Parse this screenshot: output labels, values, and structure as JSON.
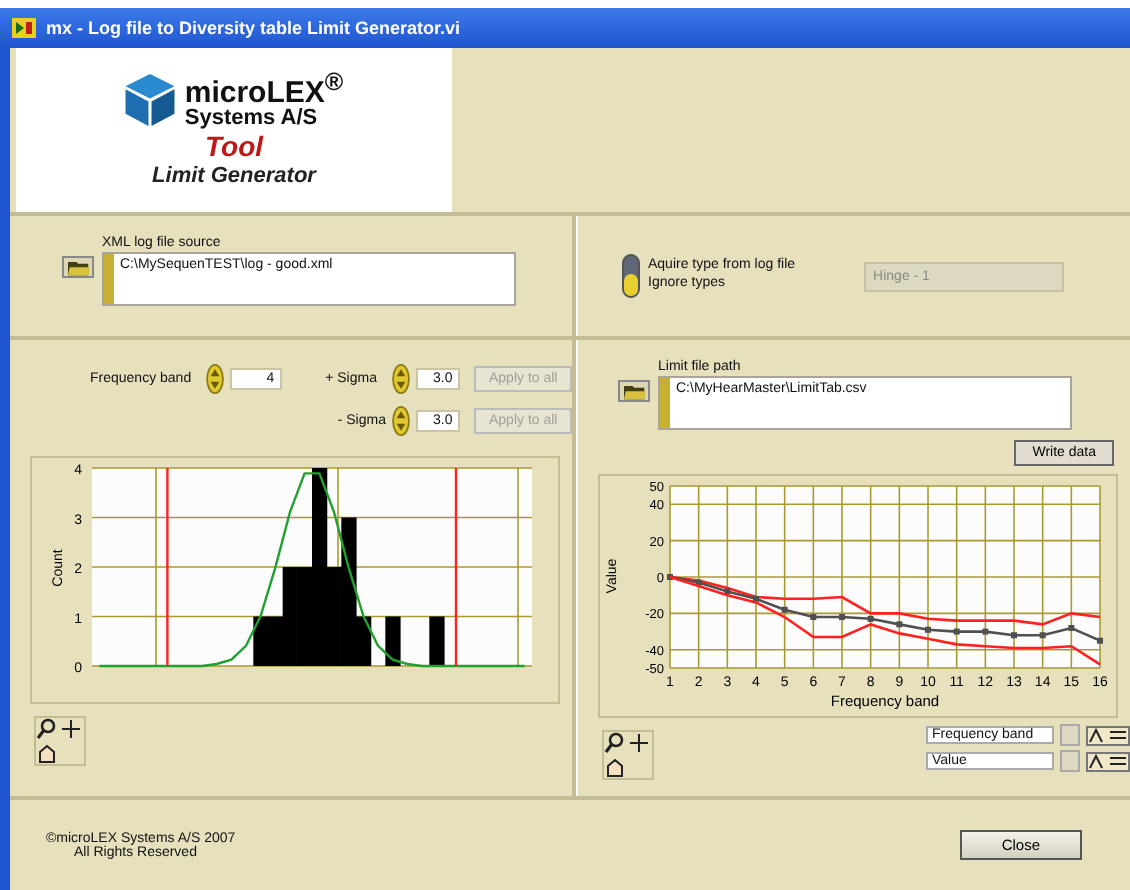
{
  "window": {
    "title": "mx - Log file to Diversity table Limit Generator.vi"
  },
  "logo": {
    "name": "microLEX$^{®}$",
    "company": "Systems A/S",
    "product": "Tool",
    "subtitle": "Limit Generator"
  },
  "source": {
    "label": "XML log file source",
    "value": "C:\\MySequenTEST\\log - good.xml"
  },
  "type_switch": {
    "on": false,
    "labels": [
      "Aquire type from log file",
      "Ignore types"
    ]
  },
  "type_field": {
    "value": "Hinge - 1",
    "disabled": true
  },
  "band_controls": [
    {
      "label": "Frequency band",
      "value": "4"
    },
    {
      "label": "+ Sigma",
      "value": "3.0",
      "button": "Apply to all",
      "disabled": true
    },
    {
      "label": "- Sigma",
      "value": "3.0",
      "button": "Apply to all",
      "disabled": true
    }
  ],
  "histogram": {
    "chart_data": {
      "type": "bar",
      "ylabel": "Count",
      "ylim": [
        0,
        4
      ],
      "yticks": [
        0,
        1,
        2,
        3,
        4
      ],
      "grid": true,
      "series": [
        {
          "type": "bar",
          "color": "#000000",
          "values": [
            0,
            0,
            0,
            0,
            0,
            0,
            0,
            0,
            0,
            0,
            0,
            1,
            1,
            2,
            2,
            4,
            2,
            3,
            1,
            0,
            1,
            0,
            0,
            1,
            0,
            0,
            0,
            0,
            0,
            0
          ]
        },
        {
          "type": "line",
          "color": "#20a030",
          "values": [
            0,
            0,
            0,
            0,
            0,
            0,
            0,
            0,
            0.04,
            0.13,
            0.41,
            1.01,
            1.99,
            3.11,
            3.89,
            3.89,
            3.11,
            1.99,
            1.01,
            0.41,
            0.13,
            0.04,
            0,
            0,
            0,
            0,
            0,
            0,
            0,
            0
          ]
        }
      ]
    }
  },
  "limit_file": {
    "label": "Limit file path",
    "value": "C:\\MyHearMaster\\LimitTab.csv",
    "button": "Write data"
  },
  "limit_chart": {
    "chart_data": {
      "type": "line",
      "xlabel": "Frequency band",
      "ylabel": "Value",
      "grid": true,
      "x": [
        1,
        2,
        3,
        4,
        5,
        6,
        7,
        8,
        9,
        10,
        11,
        12,
        13,
        14,
        15,
        16
      ],
      "xlim": [
        1,
        16
      ],
      "xticks": [
        1,
        2,
        3,
        4,
        5,
        6,
        7,
        8,
        9,
        10,
        11,
        12,
        13,
        14,
        15,
        16
      ],
      "ylim": [
        -50,
        50
      ],
      "yticks": [
        -50,
        -40,
        -20,
        0,
        20,
        40,
        50
      ],
      "series": [
        {
          "color": "#ff2020",
          "values": [
            0,
            -2,
            -6,
            -11,
            -12,
            -12,
            -11,
            -20,
            -20,
            -23,
            -24,
            -24,
            -24,
            -26,
            -20,
            -22
          ]
        },
        {
          "color": "#505050",
          "marker": "square",
          "values": [
            0,
            -3,
            -8,
            -12,
            -18,
            -22,
            -22,
            -23,
            -26,
            -29,
            -30,
            -30,
            -32,
            -32,
            -28,
            -35
          ]
        },
        {
          "color": "#ff2020",
          "values": [
            0,
            -5,
            -10,
            -14,
            -22,
            -33,
            -33,
            -26,
            -31,
            -34,
            -37,
            -38,
            -39,
            -39,
            -38,
            -48
          ]
        }
      ]
    }
  },
  "cursor_legend": [
    {
      "value": "Frequency band"
    },
    {
      "value": "Value"
    }
  ],
  "footer": {
    "copyright": "©microLEX Systems A/S 2007",
    "rights": "All Rights Reserved",
    "button": "Close"
  }
}
